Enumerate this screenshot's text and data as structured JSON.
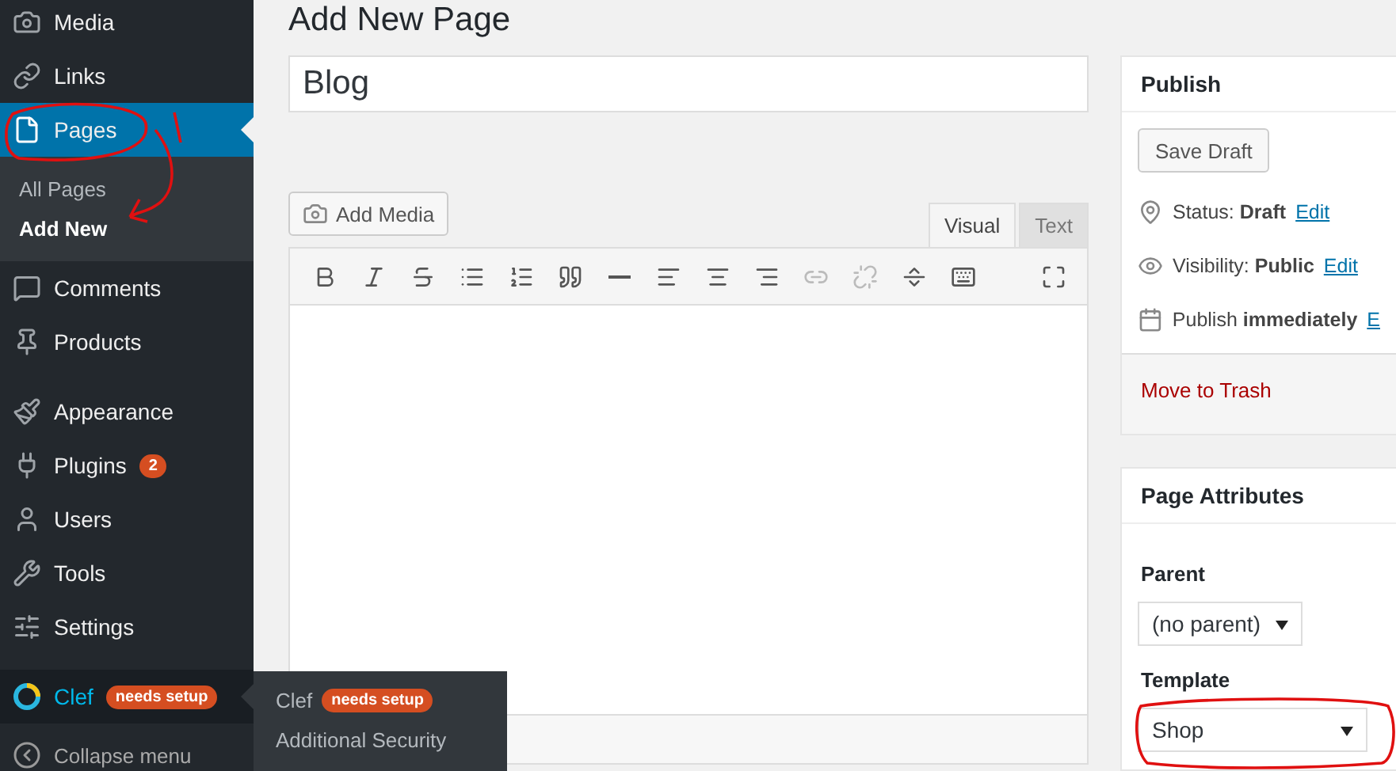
{
  "sidebar": {
    "groups": [
      [
        {
          "kind": "media",
          "label": "Media",
          "selected": false,
          "hovered": false
        },
        {
          "kind": "links",
          "label": "Links",
          "selected": false,
          "hovered": false
        },
        {
          "kind": "pages",
          "label": "Pages",
          "selected": true,
          "hovered": false,
          "children": [
            {
              "label": "All Pages",
              "selected": false
            },
            {
              "label": "Add New",
              "selected": true
            }
          ]
        },
        {
          "kind": "comments",
          "label": "Comments",
          "selected": false,
          "hovered": false
        },
        {
          "kind": "products",
          "label": "Products",
          "selected": false,
          "hovered": false
        }
      ],
      [
        {
          "kind": "appearance",
          "label": "Appearance",
          "selected": false,
          "hovered": false
        },
        {
          "kind": "plugins",
          "label": "Plugins",
          "badge": "2",
          "selected": false,
          "hovered": false
        },
        {
          "kind": "users",
          "label": "Users",
          "selected": false,
          "hovered": false
        },
        {
          "kind": "tools",
          "label": "Tools",
          "selected": false,
          "hovered": false
        },
        {
          "kind": "settings",
          "label": "Settings",
          "selected": false,
          "hovered": false
        }
      ],
      [
        {
          "kind": "clef",
          "label": "Clef",
          "badge": "needs setup",
          "selected": false,
          "hovered": true
        }
      ]
    ],
    "collapse": "Collapse menu"
  },
  "flyout": {
    "items": [
      {
        "label": "Clef",
        "badge": "needs setup"
      },
      {
        "label": "Additional Security"
      }
    ]
  },
  "main": {
    "title": "Add New Page",
    "title_field": "Blog",
    "add_media": "Add Media",
    "editor_tabs": [
      {
        "label": "Visual",
        "selected": true
      },
      {
        "label": "Text",
        "selected": false
      }
    ],
    "toolbar": [
      {
        "kind": "bold",
        "disabled": false
      },
      {
        "kind": "italic",
        "disabled": false
      },
      {
        "kind": "strike",
        "disabled": false
      },
      {
        "kind": "bullets",
        "disabled": false
      },
      {
        "kind": "numbers",
        "disabled": false
      },
      {
        "kind": "quote",
        "disabled": false
      },
      {
        "kind": "rule",
        "disabled": false
      },
      {
        "kind": "left",
        "disabled": false
      },
      {
        "kind": "center",
        "disabled": false
      },
      {
        "kind": "right",
        "disabled": false
      },
      {
        "kind": "link",
        "disabled": true
      },
      {
        "kind": "unlink",
        "disabled": true
      },
      {
        "kind": "more",
        "disabled": false
      },
      {
        "kind": "kitchen",
        "disabled": false
      },
      {
        "kind": "fullscreen",
        "disabled": false
      }
    ]
  },
  "publish": {
    "title": "Publish",
    "save_draft": "Save Draft",
    "rows": [
      {
        "kind": "status",
        "label": "Status:",
        "value": "Draft",
        "link": "Edit"
      },
      {
        "kind": "visibility",
        "label": "Visibility:",
        "value": "Public",
        "link": "Edit"
      },
      {
        "kind": "schedule",
        "label": "Publish",
        "value": "immediately",
        "link": "E"
      }
    ],
    "trash": "Move to Trash"
  },
  "page_attributes": {
    "title": "Page Attributes",
    "parent_label": "Parent",
    "parent": "(no parent)",
    "template_label": "Template",
    "template": "Shop"
  }
}
